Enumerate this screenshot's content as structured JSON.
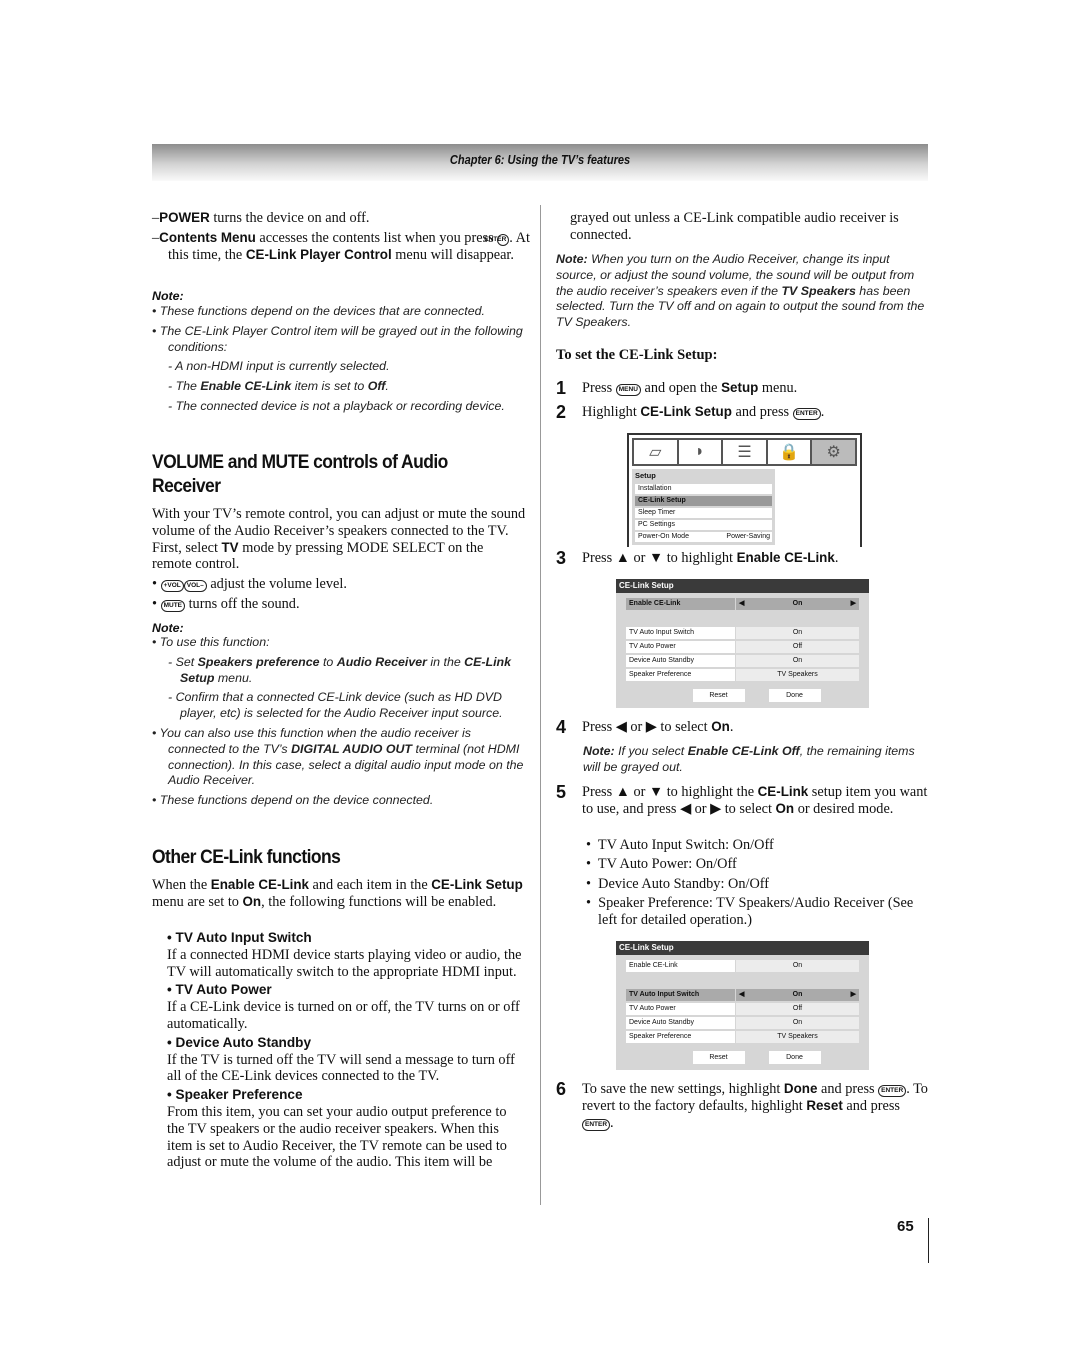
{
  "header": {
    "chapter": "Chapter 6: Using the TV’s features"
  },
  "page_number": "65",
  "left": {
    "power": [
      {
        "t": "–",
        "s": ""
      },
      {
        "t": "POWER",
        "s": "b"
      },
      {
        "t": " turns the device on and off.",
        "s": ""
      }
    ],
    "contents": [
      {
        "t": "–",
        "s": ""
      },
      {
        "t": "Contents Menu",
        "s": "b"
      },
      {
        "t": " accesses the contents list when you press ",
        "s": ""
      },
      {
        "t": "ENTER",
        "s": "key"
      },
      {
        "t": ". At this time, the ",
        "s": ""
      },
      {
        "t": "CE-Link Player Control",
        "s": "b"
      },
      {
        "t": " menu will disappear.",
        "s": ""
      }
    ],
    "note1_label": "Note:",
    "note1": [
      [
        {
          "t": "• These functions depend on the devices that are connected.",
          "s": ""
        }
      ],
      [
        {
          "t": "• The CE-Link Player Control item will be grayed out in the following conditions:",
          "s": ""
        }
      ]
    ],
    "note1_sub": [
      [
        {
          "t": "- A non-HDMI input is currently selected.",
          "s": ""
        }
      ],
      [
        {
          "t": "- The ",
          "s": ""
        },
        {
          "t": "Enable CE-Link",
          "s": "bi"
        },
        {
          "t": " item is set to ",
          "s": ""
        },
        {
          "t": "Off",
          "s": "bi"
        },
        {
          "t": ".",
          "s": ""
        }
      ],
      [
        {
          "t": "- The connected device is not a playback or recording device.",
          "s": ""
        }
      ]
    ],
    "heading1": "VOLUME and MUTE controls of Audio Receiver",
    "para1": [
      {
        "t": "With your TV’s remote control, you can adjust or mute the sound volume of the Audio Receiver’s speakers connected to the TV. First, select ",
        "s": ""
      },
      {
        "t": "TV",
        "s": "b"
      },
      {
        "t": " mode by pressing MODE SELECT on the remote control.",
        "s": ""
      }
    ],
    "bullet_vol": [
      {
        "t": "• ",
        "s": ""
      },
      {
        "t": "+VOL",
        "s": "key"
      },
      {
        "t": "VOL–",
        "s": "key"
      },
      {
        "t": " adjust the volume level.",
        "s": ""
      }
    ],
    "bullet_mute": [
      {
        "t": "• ",
        "s": ""
      },
      {
        "t": "MUTE",
        "s": "key"
      },
      {
        "t": " turns off the sound.",
        "s": ""
      }
    ],
    "note2_label": "Note:",
    "note2_a": [
      {
        "t": "• To use this function:",
        "s": ""
      }
    ],
    "note2_sub": [
      [
        {
          "t": "- Set ",
          "s": ""
        },
        {
          "t": "Speakers preference",
          "s": "bi"
        },
        {
          "t": " to ",
          "s": ""
        },
        {
          "t": "Audio Receiver",
          "s": "bi"
        },
        {
          "t": " in the ",
          "s": ""
        },
        {
          "t": "CE-Link Setup",
          "s": "bi"
        },
        {
          "t": " menu.",
          "s": ""
        }
      ],
      [
        {
          "t": "- Confirm that a connected CE-Link device (such as HD DVD player, etc) is selected for the Audio Receiver input source.",
          "s": ""
        }
      ]
    ],
    "note2_b": [
      [
        {
          "t": "• You can also use this function when the audio receiver is connected to the TV’s ",
          "s": ""
        },
        {
          "t": "DIGITAL AUDIO OUT",
          "s": "bi"
        },
        {
          "t": " terminal (not HDMI connection). In this case, select a digital audio input mode on the Audio Receiver.",
          "s": ""
        }
      ],
      [
        {
          "t": "• These functions depend on the device connected.",
          "s": ""
        }
      ]
    ],
    "heading2": "Other CE-Link functions",
    "para2": [
      {
        "t": "When the ",
        "s": ""
      },
      {
        "t": "Enable CE-Link",
        "s": "b"
      },
      {
        "t": " and each item in the ",
        "s": ""
      },
      {
        "t": "CE-Link Setup",
        "s": "b"
      },
      {
        "t": " menu are set to ",
        "s": ""
      },
      {
        "t": "On",
        "s": "b"
      },
      {
        "t": ", the following functions will be enabled.",
        "s": ""
      }
    ],
    "functions": [
      {
        "title": "TV Auto Input Switch",
        "desc": "If a connected HDMI device starts playing video or audio, the TV will automatically switch to the appropriate HDMI input."
      },
      {
        "title": "TV Auto Power",
        "desc": "If a CE-Link device is turned on or off, the TV turns on or off automatically."
      },
      {
        "title": "Device Auto Standby",
        "desc": "If the TV is turned off the TV will send a message to turn off all of the CE-Link devices connected to the TV."
      },
      {
        "title": "Speaker Preference",
        "desc": "From this item, you can set your audio output preference to the TV speakers or the audio receiver speakers. When this item is set to Audio Receiver, the TV remote can be used to adjust or mute the volume of the audio. This item will be"
      }
    ]
  },
  "right": {
    "cont": "grayed out unless a CE-Link compatible audio receiver is connected.",
    "note1": [
      {
        "t": "Note:",
        "s": "bi"
      },
      {
        "t": " When you turn on the Audio Receiver, change its input source, or adjust the sound volume, the sound will be output from the audio receiver’s speakers even if the ",
        "s": ""
      },
      {
        "t": "TV Speakers",
        "s": "bi"
      },
      {
        "t": " has been selected. Turn the TV off and on again to output the sound from the TV Speakers.",
        "s": ""
      }
    ],
    "heading": "To set the CE-Link Setup:",
    "step1": [
      {
        "t": "Press ",
        "s": ""
      },
      {
        "t": "MENU",
        "s": "key"
      },
      {
        "t": " and open the ",
        "s": ""
      },
      {
        "t": "Setup",
        "s": "b"
      },
      {
        "t": " menu.",
        "s": ""
      }
    ],
    "step2": [
      {
        "t": "Highlight ",
        "s": ""
      },
      {
        "t": "CE-Link Setup",
        "s": "b"
      },
      {
        "t": " and press ",
        "s": ""
      },
      {
        "t": "ENTER",
        "s": "key"
      },
      {
        "t": ".",
        "s": ""
      }
    ],
    "step3": [
      {
        "t": "Press ▲ or ▼ to highlight ",
        "s": ""
      },
      {
        "t": "Enable CE-Link",
        "s": "b"
      },
      {
        "t": ".",
        "s": ""
      }
    ],
    "step4": [
      {
        "t": "Press ◀ or ▶ to select ",
        "s": ""
      },
      {
        "t": "On",
        "s": "b"
      },
      {
        "t": ".",
        "s": ""
      }
    ],
    "note2": [
      {
        "t": "Note:",
        "s": "bi"
      },
      {
        "t": " If you select ",
        "s": ""
      },
      {
        "t": "Enable CE-Link Off",
        "s": "bi"
      },
      {
        "t": ", the remaining items will be grayed out.",
        "s": ""
      }
    ],
    "step5": [
      {
        "t": "Press ▲ or ▼ to highlight the ",
        "s": ""
      },
      {
        "t": "CE-Link",
        "s": "b"
      },
      {
        "t": " setup item you want to use, and press ◀ or ▶ to select ",
        "s": ""
      },
      {
        "t": "On",
        "s": "b"
      },
      {
        "t": " or desired mode.",
        "s": ""
      }
    ],
    "bullets": [
      "TV Auto Input Switch: On/Off",
      "TV Auto Power: On/Off",
      "Device Auto Standby: On/Off",
      "Speaker Preference: TV Speakers/Audio Receiver (See left for detailed operation.)"
    ],
    "step6": [
      {
        "t": "To save the new settings, highlight ",
        "s": ""
      },
      {
        "t": "Done",
        "s": "b"
      },
      {
        "t": " and press ",
        "s": ""
      },
      {
        "t": "ENTER",
        "s": "key"
      },
      {
        "t": ". To revert to the factory defaults, highlight ",
        "s": ""
      },
      {
        "t": "Reset",
        "s": "b"
      },
      {
        "t": " and press ",
        "s": ""
      },
      {
        "t": "ENTER",
        "s": "key"
      },
      {
        "t": ".",
        "s": ""
      }
    ],
    "step_numbers": [
      "1",
      "2",
      "3",
      "4",
      "5",
      "6"
    ]
  },
  "setup_menu": {
    "title": "Setup",
    "items": [
      "Installation",
      "CE-Link Setup",
      "Sleep Timer",
      "PC Settings",
      "Power-On Mode"
    ],
    "power_on_value": "Power-Saving",
    "highlighted": "CE-Link Setup",
    "icons": [
      "picture-icon",
      "sound-icon",
      "preferences-icon",
      "lock-icon",
      "setup-gear-icon"
    ]
  },
  "celink_tables": [
    {
      "title": "CE-Link Setup",
      "highlight": 0,
      "rows": [
        [
          "Enable CE-Link",
          "On"
        ],
        [
          "TV Auto Input Switch",
          "On"
        ],
        [
          "TV Auto Power",
          "Off"
        ],
        [
          "Device Auto Standby",
          "On"
        ],
        [
          "Speaker Preference",
          "TV Speakers"
        ]
      ],
      "reset": "Reset",
      "done": "Done"
    },
    {
      "title": "CE-Link Setup",
      "highlight": 1,
      "rows": [
        [
          "Enable CE-Link",
          "On"
        ],
        [
          "TV Auto Input Switch",
          "On"
        ],
        [
          "TV Auto Power",
          "Off"
        ],
        [
          "Device Auto Standby",
          "On"
        ],
        [
          "Speaker Preference",
          "TV Speakers"
        ]
      ],
      "reset": "Reset",
      "done": "Done"
    }
  ]
}
